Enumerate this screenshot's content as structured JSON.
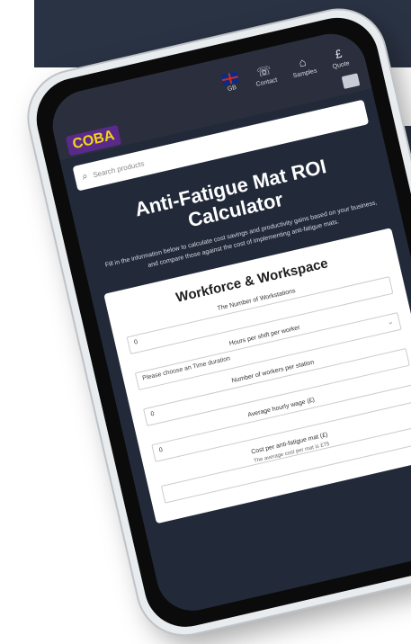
{
  "header": {
    "items": [
      {
        "label": "GB",
        "icon": "uk-flag-icon"
      },
      {
        "label": "Contact",
        "icon": "phone-icon"
      },
      {
        "label": "Samples",
        "icon": "basket-icon"
      },
      {
        "label": "Quote",
        "icon": "pound-icon",
        "glyph": "£"
      }
    ]
  },
  "brand": {
    "logo": "COBA",
    "logo_bg": "#5a2a8a",
    "logo_fg": "#f5d417"
  },
  "search": {
    "placeholder": "Search products"
  },
  "page": {
    "title": "Anti-Fatigue Mat ROI Calculator",
    "intro": "Fill in the information below to calculate cost savings and productivity gains based on your business, and compare those against the cost of implementing anti-fatigue mats."
  },
  "form": {
    "section_title": "Workforce & Workspace",
    "fields": [
      {
        "label": "The Number of Workstations",
        "value": "0"
      },
      {
        "label": "Hours per shift per worker",
        "placeholder": "Please choose an Time duration"
      },
      {
        "label": "Number of workers per station",
        "value": "0"
      },
      {
        "label": "Average hourly wage (£)",
        "value": "0"
      },
      {
        "label": "Cost per anti-fatigue mat (£)",
        "hint": "The average cost per mat is £75"
      }
    ]
  },
  "colors": {
    "page_bg": "#222a3a",
    "banner": "#2a3344"
  }
}
